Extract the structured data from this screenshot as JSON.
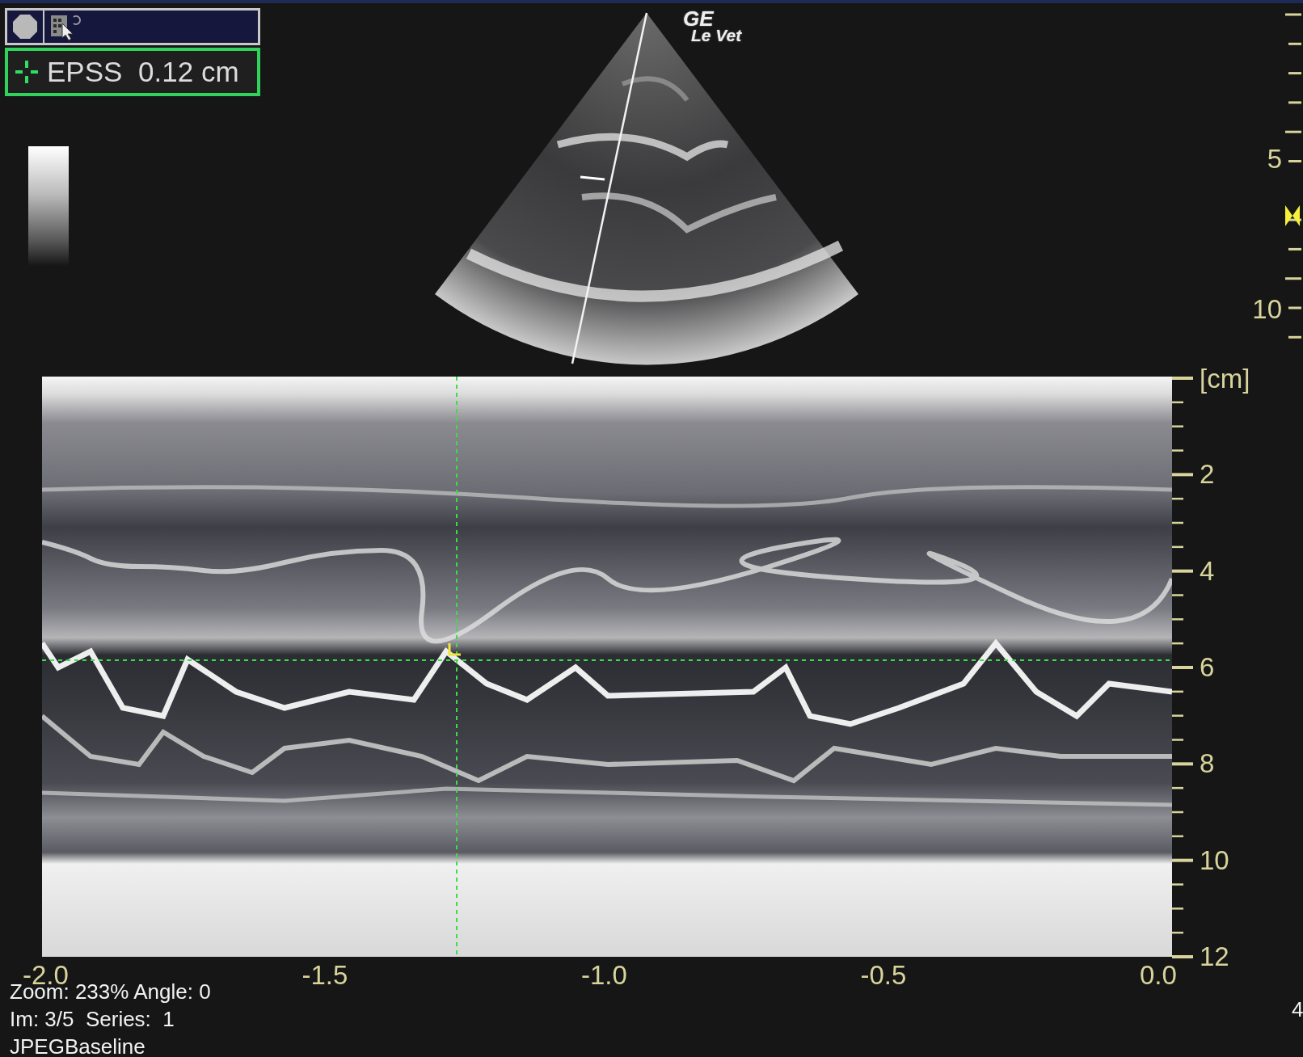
{
  "measurement": {
    "label": "EPSS",
    "value": "0.12 cm"
  },
  "logo": {
    "line_1": "GE",
    "line_2": "Le Vet"
  },
  "sector_scale": {
    "labels": [
      "5",
      "10"
    ]
  },
  "mmode": {
    "depth_unit": "[cm]",
    "depth_labels": [
      "2",
      "4",
      "6",
      "8",
      "10",
      "12"
    ],
    "time_labels": [
      "-2.0",
      "-1.5",
      "-1.0",
      "-0.5",
      "0.0"
    ]
  },
  "info": [
    "Zoom: 233% Angle: 0",
    "Im: 3/5  Series:  1",
    "JPEGBaseline"
  ],
  "edge_text": "4"
}
